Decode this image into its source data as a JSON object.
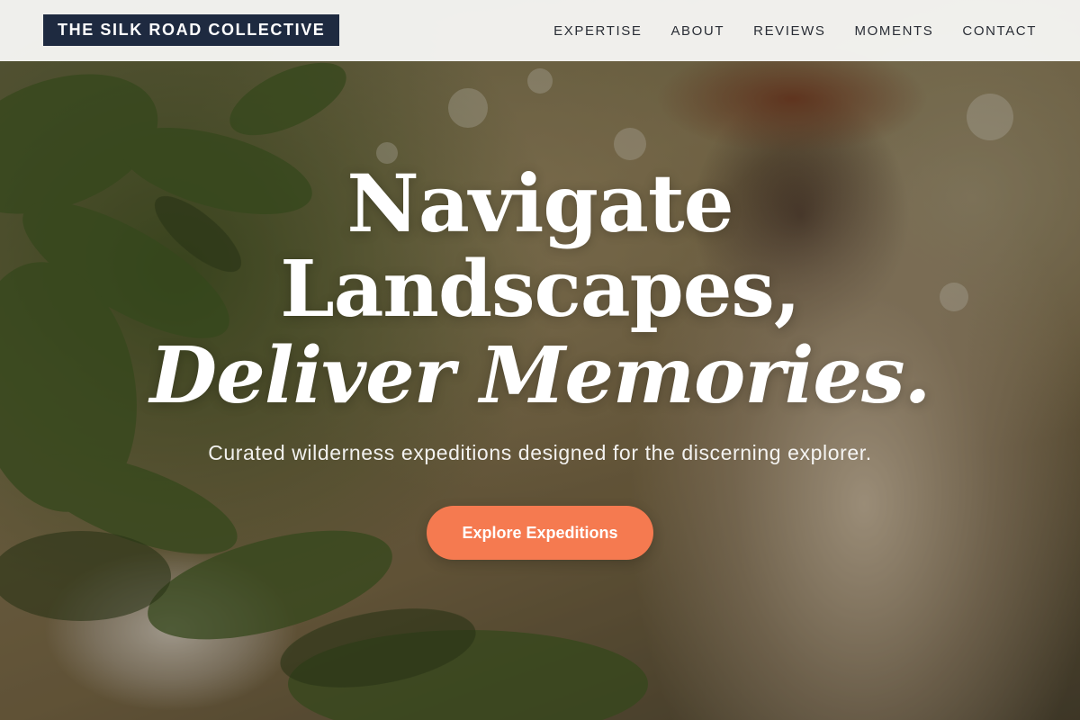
{
  "brand": {
    "name": "THE SILK ROAD COLLECTIVE"
  },
  "nav": {
    "items": [
      {
        "label": "EXPERTISE"
      },
      {
        "label": "ABOUT"
      },
      {
        "label": "REVIEWS"
      },
      {
        "label": "MOMENTS"
      },
      {
        "label": "CONTACT"
      }
    ]
  },
  "hero": {
    "headline_line1": "Navigate",
    "headline_line2": "Landscapes,",
    "headline_line3": "Deliver Memories.",
    "subtitle": "Curated wilderness expeditions designed for the discerning explorer.",
    "cta_label": "Explore Expeditions",
    "background_image": "smiling traveler in beige jacket pointing through forest foliage"
  },
  "colors": {
    "brand_bg": "#1e2a40",
    "header_bg": "#f6f6f4",
    "accent": "#f57a50",
    "text_light": "#ffffff"
  }
}
